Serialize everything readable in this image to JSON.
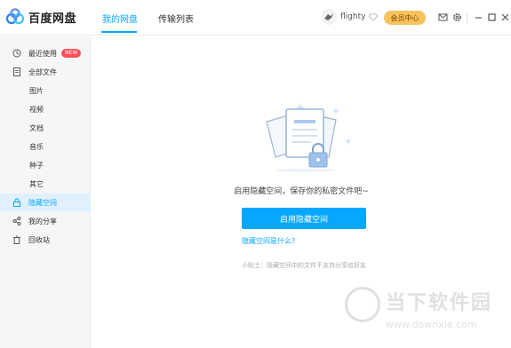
{
  "app": {
    "name": "百度网盘"
  },
  "tabs": [
    {
      "label": "我的网盘",
      "active": true
    },
    {
      "label": "传输列表",
      "active": false
    }
  ],
  "user": {
    "name": "flighty",
    "vip_label": "会员中心"
  },
  "sidebar": {
    "items": [
      {
        "label": "最近使用",
        "icon": "clock-icon",
        "badge": "NEW"
      },
      {
        "label": "全部文件",
        "icon": "file-icon"
      },
      {
        "label": "图片"
      },
      {
        "label": "视频"
      },
      {
        "label": "文档"
      },
      {
        "label": "音乐"
      },
      {
        "label": "种子"
      },
      {
        "label": "其它"
      },
      {
        "label": "隐藏空间",
        "icon": "lock-icon",
        "active": true
      },
      {
        "label": "我的分享",
        "icon": "share-icon"
      },
      {
        "label": "回收站",
        "icon": "trash-icon"
      }
    ]
  },
  "main": {
    "description": "启用隐藏空间，保存你的私密文件吧~",
    "enable_button": "启用隐藏空间",
    "what_link": "隐藏空间是什么?",
    "tip": "小贴士：隐藏空间中的文件不支持分享给好友"
  },
  "watermark": {
    "brand": "当下软件园",
    "url": "www.downxia.com"
  },
  "colors": {
    "accent": "#06a7ff",
    "vip": "#f6c35c",
    "badge": "#ff4d5a",
    "sidebar_bg": "#f5f6f8",
    "active_bg": "#e0f1fd"
  }
}
